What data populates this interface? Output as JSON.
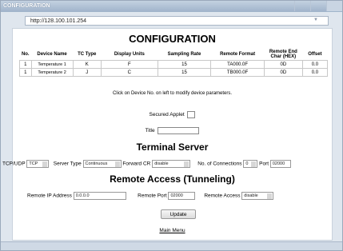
{
  "window": {
    "title": "CONFIGURATION"
  },
  "address": {
    "url": "http://128.100.101.254"
  },
  "page": {
    "title": "CONFIGURATION"
  },
  "table": {
    "headers": [
      "No.",
      "Device Name",
      "TC Type",
      "Display Units",
      "Sampling Rate",
      "Remote Format",
      "Remote End Char (HEX)",
      "Offset"
    ],
    "rows": [
      [
        "1",
        "Temperature 1",
        "K",
        "F",
        "15",
        "TA000.0F",
        "0D",
        "0.0"
      ],
      [
        "1",
        "Temperature 2",
        "J",
        "C",
        "15",
        "TB000.0F",
        "0D",
        "0.0"
      ]
    ]
  },
  "hint": "Click on Device No. on left to modify device parameters.",
  "secured_applet_label": "Secured Applet",
  "title_label": "Title",
  "terminal": {
    "heading": "Terminal Server",
    "tcpudp_label": "TCP/UDP",
    "tcpudp_value": "TCP",
    "server_type_label": "Server Type",
    "server_type_value": "Continuous",
    "forward_cr_label": "Forward CR",
    "forward_cr_value": "disable",
    "connections_label": "No. of Connections",
    "connections_value": "0",
    "port_label": "Port",
    "port_value": "02000"
  },
  "remote": {
    "heading": "Remote Access (Tunneling)",
    "ip_label": "Remote IP Address",
    "ip_value": "0.0.0.0",
    "port_label": "Remote Port",
    "port_value": "02000",
    "access_label": "Remote Access",
    "access_value": "disable"
  },
  "update_label": "Update",
  "main_menu_label": "Main Menu"
}
